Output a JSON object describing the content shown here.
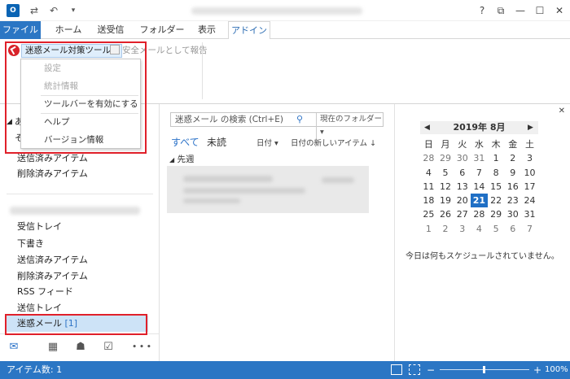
{
  "titlebar": {
    "app_icon": "O",
    "qa_icons": [
      "send-receive-icon",
      "undo-icon",
      "customize-icon"
    ],
    "window_buttons": [
      "?",
      "⧉",
      "—",
      "☐",
      "✕"
    ]
  },
  "tabs": [
    {
      "label": "ファイル",
      "active": false
    },
    {
      "label": "ホーム",
      "active": false
    },
    {
      "label": "送受信",
      "active": false
    },
    {
      "label": "フォルダー",
      "active": false
    },
    {
      "label": "表示",
      "active": false
    },
    {
      "label": "アドイン",
      "active": true
    }
  ],
  "ribbon": {
    "tool_button_label": "迷惑メール対策ツール",
    "report_label": "安全メールとして報告",
    "dropdown_items": [
      {
        "label": "設定",
        "disabled": true
      },
      {
        "label": "統計情報",
        "disabled": true
      },
      {
        "label": "ツールバーを有効にする",
        "disabled": false
      },
      {
        "label": "ヘルプ",
        "disabled": false
      },
      {
        "label": "バージョン情報",
        "disabled": false
      }
    ]
  },
  "nav": {
    "group_top": [
      "送信済みアイテム",
      "削除済みアイテム"
    ],
    "folders": [
      "受信トレイ",
      "下書き",
      "送信済みアイテム",
      "削除済みアイテム",
      "RSS フィード",
      "送信トレイ"
    ],
    "junk_label": "迷惑メール",
    "junk_count": "[1]",
    "fragments": [
      "あ",
      "そ"
    ]
  },
  "navbar_icons": [
    "mail-icon",
    "calendar-icon",
    "people-icon",
    "tasks-icon",
    "more-icon"
  ],
  "navbar_more": "• • •",
  "msglist": {
    "search_placeholder": "迷惑メール の検索 (Ctrl+E)",
    "search_scope": "現在のフォルダー",
    "filter_all": "すべて",
    "filter_unread": "未読",
    "sort_date": "日付",
    "sort_order": "日付の新しいアイテム",
    "group_header": "先週"
  },
  "calendar": {
    "title": "2019年 8月",
    "weekdays": [
      "日",
      "月",
      "火",
      "水",
      "木",
      "金",
      "土"
    ],
    "weeks": [
      [
        "28",
        "29",
        "30",
        "31",
        "1",
        "2",
        "3"
      ],
      [
        "4",
        "5",
        "6",
        "7",
        "8",
        "9",
        "10"
      ],
      [
        "11",
        "12",
        "13",
        "14",
        "15",
        "16",
        "17"
      ],
      [
        "18",
        "19",
        "20",
        "21",
        "22",
        "23",
        "24"
      ],
      [
        "25",
        "26",
        "27",
        "28",
        "29",
        "30",
        "31"
      ],
      [
        "1",
        "2",
        "3",
        "4",
        "5",
        "6",
        "7"
      ]
    ],
    "today": "21",
    "no_schedule": "今日は何もスケジュールされていません。"
  },
  "status": {
    "item_count": "アイテム数: 1",
    "zoom": "100%"
  },
  "colors": {
    "accent": "#2b76c4",
    "highlight_box": "#e0202a",
    "selected_row": "#cde3f7"
  }
}
